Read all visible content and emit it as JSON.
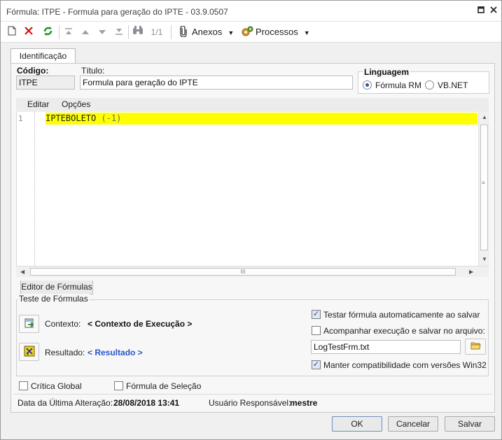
{
  "window": {
    "title": "Fórmula: ITPE - Formula para geração do IPTE - 03.9.0507",
    "restore_icon": "restore-icon",
    "close_icon": "close-icon"
  },
  "toolbar": {
    "page_indicator": "1/1",
    "anexos_label": "Anexos",
    "processos_label": "Processos",
    "icons": [
      "new-document-icon",
      "delete-icon",
      "refresh-icon",
      "first-record-icon",
      "previous-record-icon",
      "next-record-icon",
      "last-record-icon",
      "search-icon",
      "attachment-icon",
      "processes-icon"
    ]
  },
  "tabs": {
    "identificacao": "Identificação"
  },
  "fields": {
    "codigo_label": "Código:",
    "codigo_value": "ITPE",
    "titulo_label": "Título:",
    "titulo_value": "Formula para geração do IPTE"
  },
  "linguagem": {
    "label": "Linguagem",
    "options": [
      {
        "label": "Fórmula RM",
        "selected": true
      },
      {
        "label": "VB.NET",
        "selected": false
      }
    ]
  },
  "editor": {
    "menu_editar": "Editar",
    "menu_opcoes": "Opções",
    "line_number": "1",
    "code_keyword": "IPTEBOLETO",
    "code_args": "(-1)",
    "highlight_color": "#ffff00",
    "grip": "III"
  },
  "bottom_tab": {
    "label": "Editor de Fórmulas"
  },
  "teste": {
    "group_label": "Teste de Fórmulas",
    "contexto_label": "Contexto:",
    "contexto_value": "< Contexto de Execução >",
    "resultado_label": "Resultado:",
    "resultado_value": "< Resultado >",
    "opt_testar": "Testar fórmula automaticamente ao salvar",
    "opt_testar_checked": true,
    "opt_acompanhar": "Acompanhar execução e salvar no arquivo:",
    "opt_acompanhar_checked": false,
    "arquivo_value": "LogTestFrm.txt",
    "opt_manter": "Manter compatibilidade com versões Win32",
    "opt_manter_checked": true
  },
  "flags": {
    "critica_global": "Crítica Global",
    "critica_global_checked": false,
    "formula_selecao": "Fórmula de Seleção",
    "formula_selecao_checked": false
  },
  "footer_info": {
    "ultima_alteracao_label": "Data da Última Alteração:",
    "ultima_alteracao_value": "28/08/2018 13:41",
    "usuario_label": "Usuário Responsável:",
    "usuario_value": "mestre"
  },
  "buttons": {
    "ok": "OK",
    "cancelar": "Cancelar",
    "salvar": "Salvar"
  }
}
